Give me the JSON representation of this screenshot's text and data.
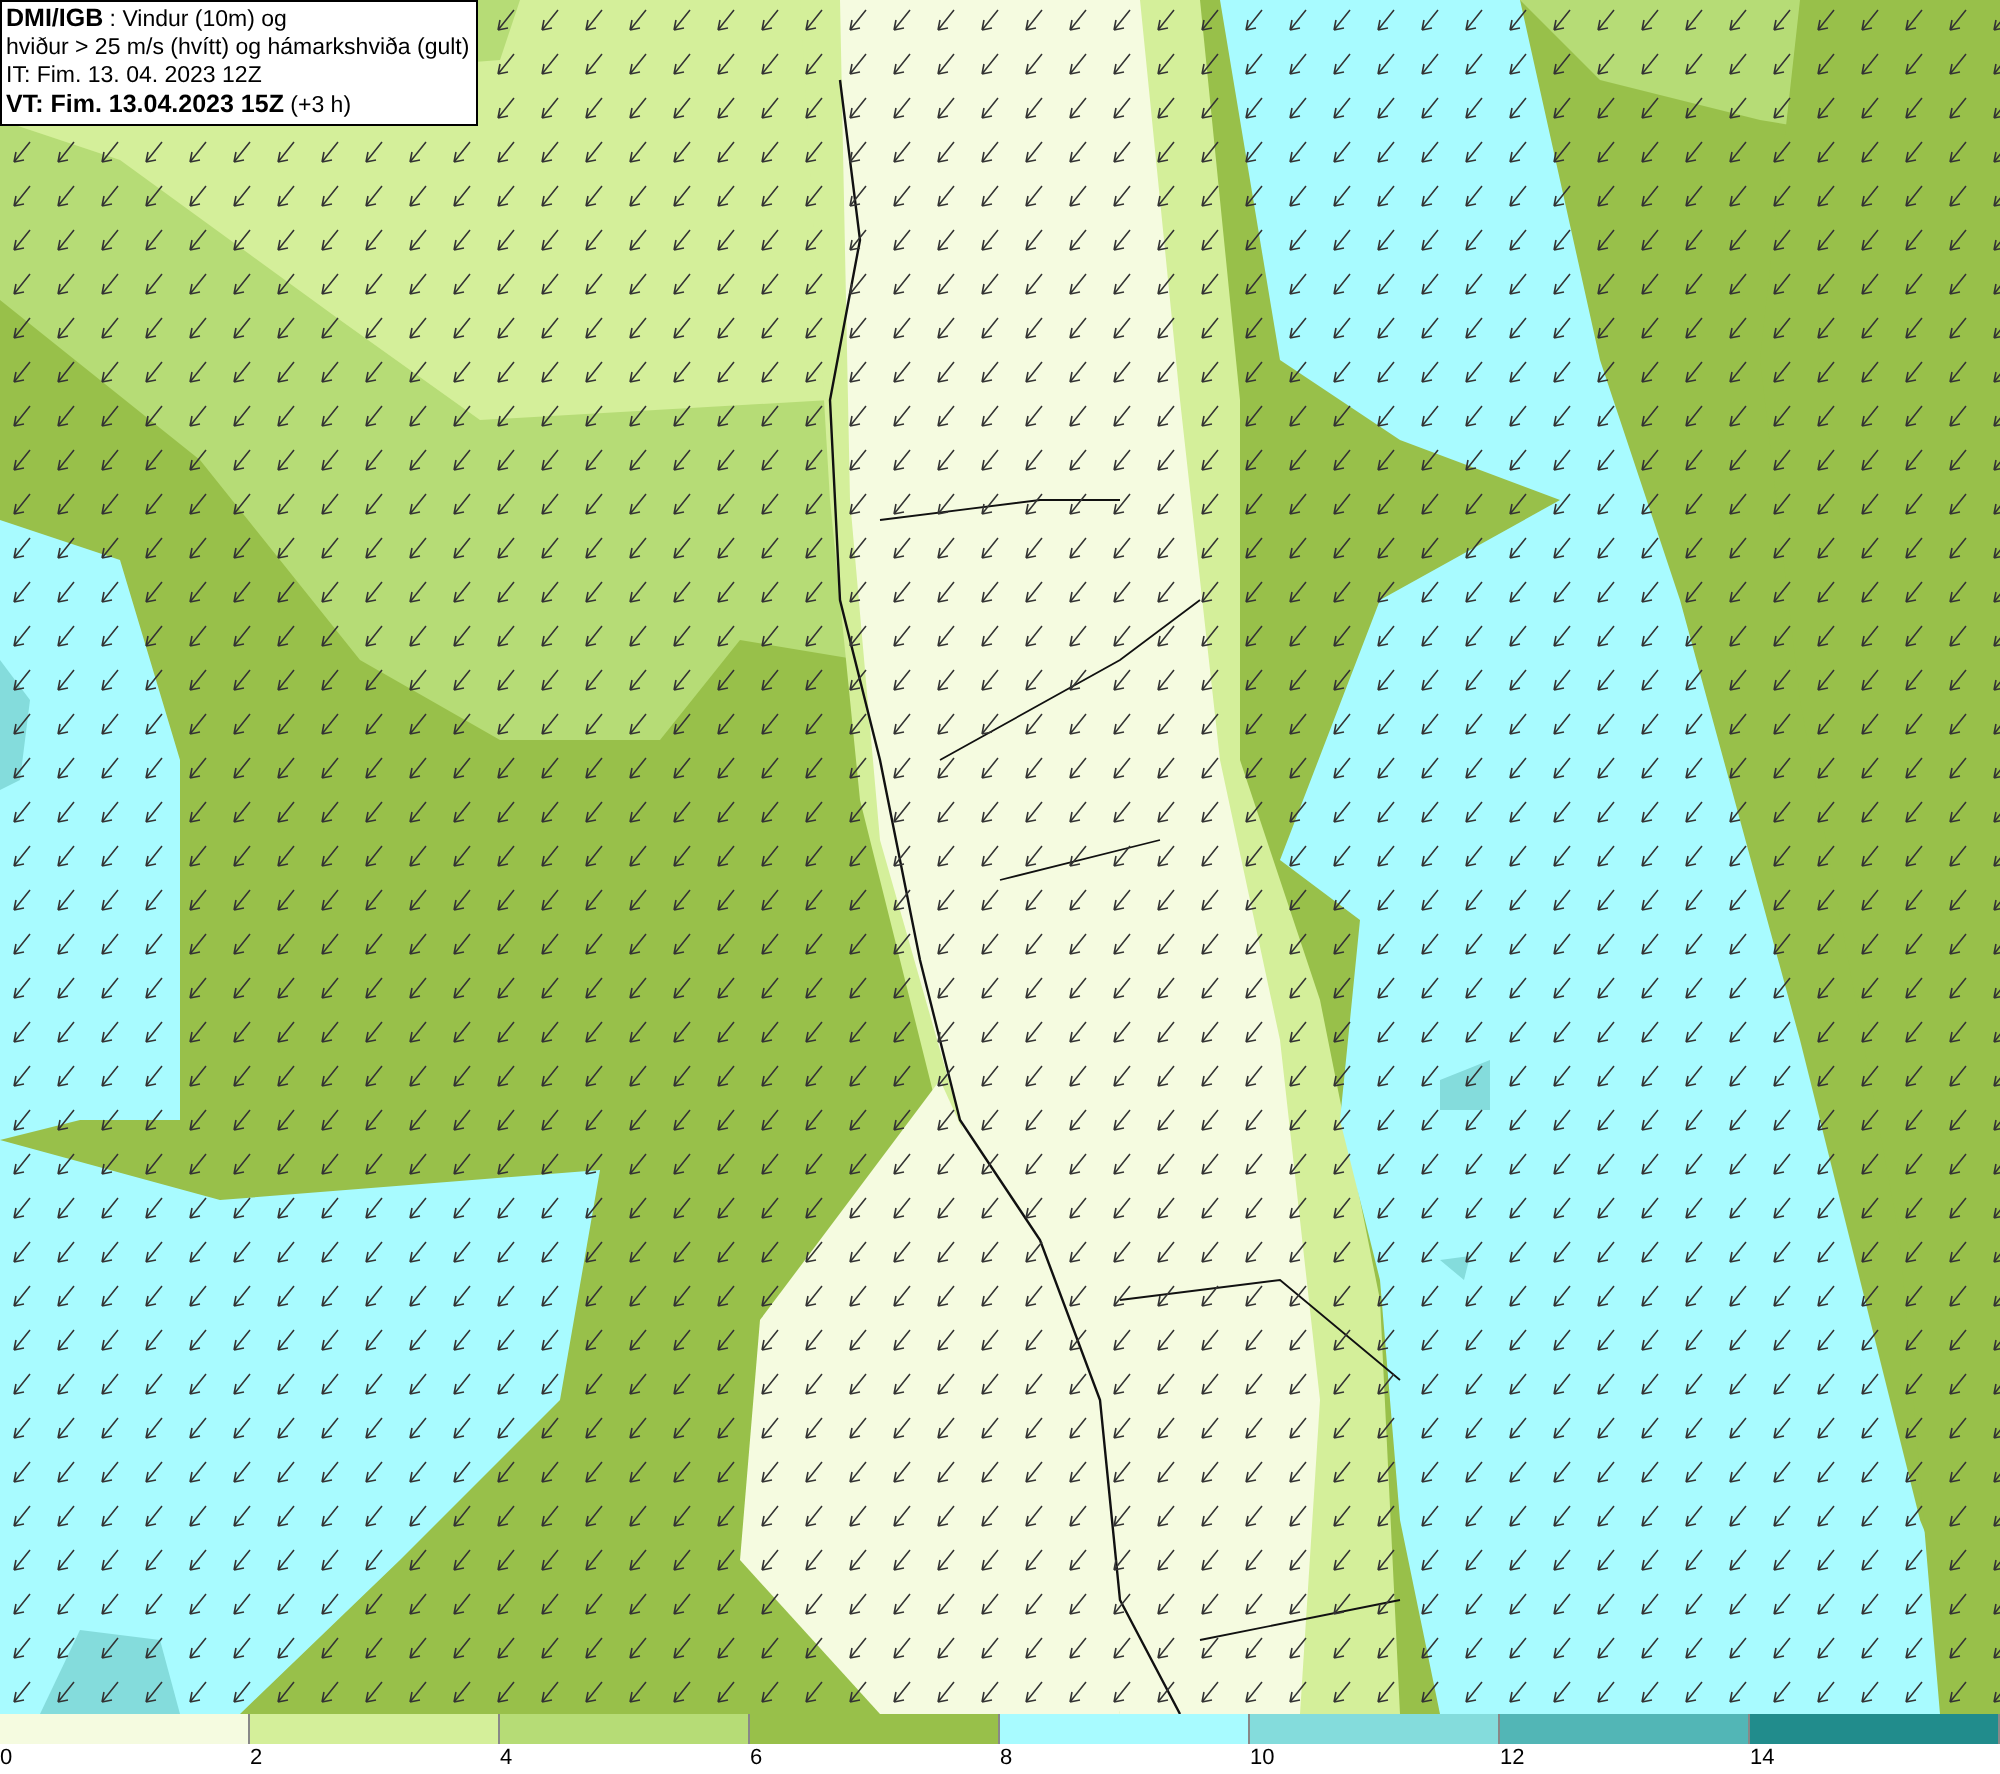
{
  "header": {
    "lines": [
      "**DMI/IGB** : Vindur (10m) og",
      "hviður > 25 m/s (hvítt) og hámarkshviða (gult)",
      "IT: Fim. 13. 04. 2023 12Z",
      "**VT: Fim. 13.04.2023 15Z** (+3 h)"
    ]
  },
  "legend": [
    {
      "label": "0",
      "color": "#f5fbe0"
    },
    {
      "label": "2",
      "color": "#d4ef9a"
    },
    {
      "label": "4",
      "color": "#b6dc76"
    },
    {
      "label": "6",
      "color": "#98c04a"
    },
    {
      "label": "8",
      "color": "#a8fbff"
    },
    {
      "label": "10",
      "color": "#84dcdc"
    },
    {
      "label": "12",
      "color": "#52b6b6"
    },
    {
      "label": "14",
      "color": "#218c8c"
    }
  ]
}
